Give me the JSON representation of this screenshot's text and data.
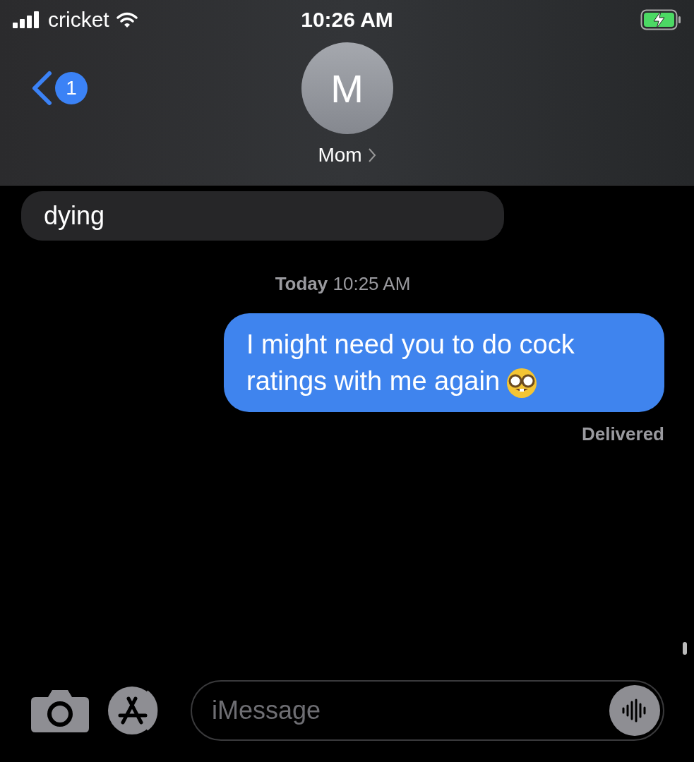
{
  "status_bar": {
    "carrier": "cricket",
    "time": "10:26 AM"
  },
  "header": {
    "unread_count": "1",
    "avatar_initial": "M",
    "contact_name": "Mom"
  },
  "messages": [
    {
      "kind": "incoming",
      "text": "dying"
    },
    {
      "kind": "timestamp",
      "text": "**Today** 10:25 AM"
    },
    {
      "kind": "outgoing",
      "text": "I might need you to do cock ratings with me again"
    },
    {
      "kind": "status",
      "text": "Delivered"
    }
  ],
  "composer": {
    "placeholder": "iMessage"
  }
}
